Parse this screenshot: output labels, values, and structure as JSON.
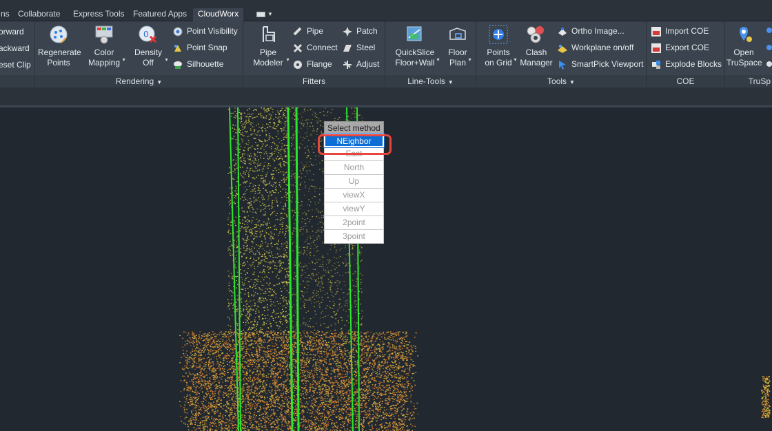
{
  "tabs": [
    "ns",
    "Collaborate",
    "Express Tools",
    "Featured Apps",
    "CloudWorx"
  ],
  "active_tab": "CloudWorx",
  "ribbon": {
    "clip_panel": {
      "items": [
        "orward",
        "ackward",
        "eset Clip"
      ]
    },
    "rendering": {
      "title": "Rendering",
      "regenerate": [
        "Regenerate",
        "Points"
      ],
      "color_mapping": [
        "Color",
        "Mapping"
      ],
      "density": [
        "Density",
        "Off"
      ],
      "point_visibility": "Point Visibility",
      "point_snap": "Point Snap",
      "silhouette": "Silhouette"
    },
    "fitters": {
      "title": "Fitters",
      "pipe_modeler": [
        "Pipe",
        "Modeler"
      ],
      "pipe": "Pipe",
      "connect": "Connect",
      "flange": "Flange",
      "patch": "Patch",
      "steel": "Steel",
      "adjust": "Adjust"
    },
    "line_tools": {
      "title": "Line-Tools",
      "quickslice": [
        "QuickSlice",
        "Floor+Wall"
      ],
      "floor_plan": [
        "Floor",
        "Plan"
      ]
    },
    "tools": {
      "title": "Tools",
      "points_on_grid": [
        "Points",
        "on Grid"
      ],
      "clash_manager": [
        "Clash",
        "Manager"
      ],
      "ortho_image": "Ortho Image...",
      "workplane": "Workplane on/off",
      "smartpick": "SmartPick Viewport"
    },
    "coe": {
      "title": "COE",
      "import": "Import COE",
      "export": "Export COE",
      "explode": "Explode Blocks"
    },
    "truspace": {
      "title": "TruSp",
      "open": [
        "Open",
        "TruSpace"
      ]
    }
  },
  "popup_menu": {
    "title": "Select method",
    "selected": "NEighbor",
    "items": [
      "NEighbor",
      "East",
      "North",
      "Up",
      "viewX",
      "viewY",
      "2point",
      "3point"
    ]
  },
  "colors": {
    "ribbon_bg": "#3a434e",
    "viewport_bg": "#212830",
    "selection_blue": "#0d6fd6",
    "highlight_red": "#e8453c",
    "fit_lines_green": "#2ee52e"
  },
  "icons": [
    "regenerate-icon",
    "color-mapping-icon",
    "density-icon",
    "point-visibility-icon",
    "point-snap-icon",
    "silhouette-icon",
    "pipe-modeler-icon",
    "pipe-icon",
    "connect-icon",
    "flange-icon",
    "patch-icon",
    "steel-icon",
    "adjust-icon",
    "quickslice-icon",
    "floor-plan-icon",
    "points-on-grid-icon",
    "clash-manager-icon",
    "ortho-image-icon",
    "workplane-icon",
    "smartpick-icon",
    "import-coe-icon",
    "export-coe-icon",
    "explode-blocks-icon",
    "truspace-icon"
  ]
}
